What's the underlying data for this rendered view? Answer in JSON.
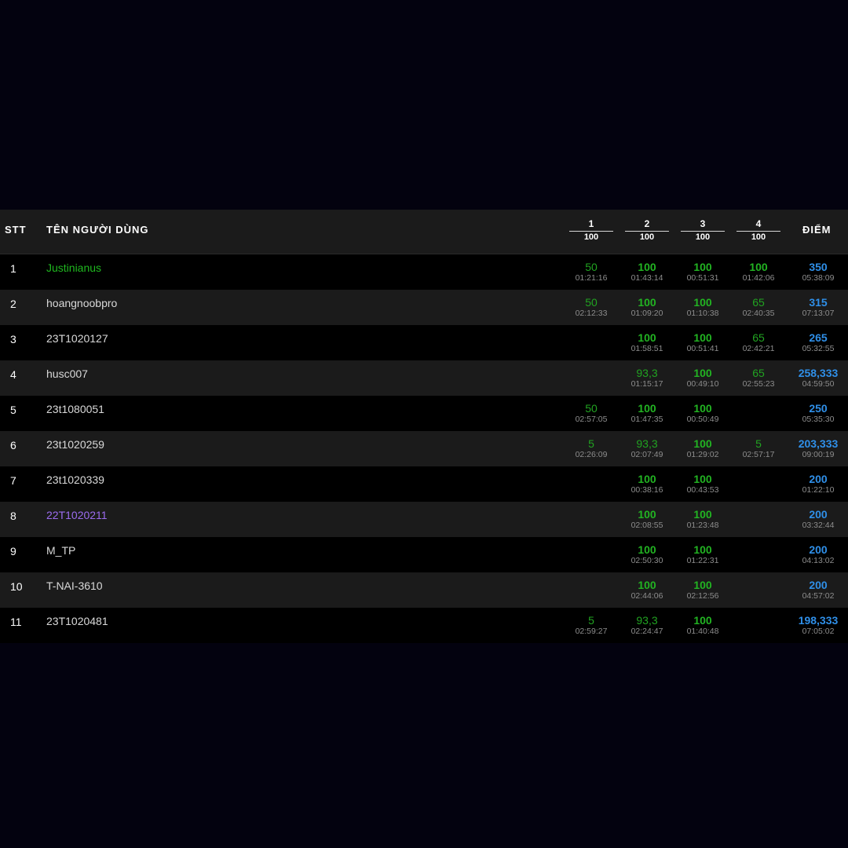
{
  "header": {
    "stt": "STT",
    "name": "TÊN NGƯỜI DÙNG",
    "score": "ĐIỂM",
    "problems": [
      {
        "num": "1",
        "max": "100"
      },
      {
        "num": "2",
        "max": "100"
      },
      {
        "num": "3",
        "max": "100"
      },
      {
        "num": "4",
        "max": "100"
      }
    ]
  },
  "colors": {
    "background": "#03020f",
    "row_dark": "#000000",
    "row_light": "#1b1b1b",
    "points_green": "#22b322",
    "score_blue": "#2f8fe8",
    "user_green": "#1fb81f",
    "user_purple": "#9b6cf0"
  },
  "rows": [
    {
      "rank": "1",
      "user": "Justinianus",
      "user_color": "green",
      "cells": [
        {
          "p": "50",
          "t": "01:21:16"
        },
        {
          "p": "100",
          "t": "01:43:14"
        },
        {
          "p": "100",
          "t": "00:51:31"
        },
        {
          "p": "100",
          "t": "01:42:06"
        }
      ],
      "score": "350",
      "total_time": "05:38:09"
    },
    {
      "rank": "2",
      "user": "hoangnoobpro",
      "user_color": "default",
      "cells": [
        {
          "p": "50",
          "t": "02:12:33"
        },
        {
          "p": "100",
          "t": "01:09:20"
        },
        {
          "p": "100",
          "t": "01:10:38"
        },
        {
          "p": "65",
          "t": "02:40:35"
        }
      ],
      "score": "315",
      "total_time": "07:13:07"
    },
    {
      "rank": "3",
      "user": "23T1020127",
      "user_color": "default",
      "cells": [
        null,
        {
          "p": "100",
          "t": "01:58:51"
        },
        {
          "p": "100",
          "t": "00:51:41"
        },
        {
          "p": "65",
          "t": "02:42:21"
        }
      ],
      "score": "265",
      "total_time": "05:32:55"
    },
    {
      "rank": "4",
      "user": "husc007",
      "user_color": "default",
      "cells": [
        null,
        {
          "p": "93,3",
          "t": "01:15:17"
        },
        {
          "p": "100",
          "t": "00:49:10"
        },
        {
          "p": "65",
          "t": "02:55:23"
        }
      ],
      "score": "258,333",
      "total_time": "04:59:50"
    },
    {
      "rank": "5",
      "user": "23t1080051",
      "user_color": "default",
      "cells": [
        {
          "p": "50",
          "t": "02:57:05"
        },
        {
          "p": "100",
          "t": "01:47:35"
        },
        {
          "p": "100",
          "t": "00:50:49"
        },
        null
      ],
      "score": "250",
      "total_time": "05:35:30"
    },
    {
      "rank": "6",
      "user": "23t1020259",
      "user_color": "default",
      "cells": [
        {
          "p": "5",
          "t": "02:26:09"
        },
        {
          "p": "93,3",
          "t": "02:07:49"
        },
        {
          "p": "100",
          "t": "01:29:02"
        },
        {
          "p": "5",
          "t": "02:57:17"
        }
      ],
      "score": "203,333",
      "total_time": "09:00:19"
    },
    {
      "rank": "7",
      "user": "23t1020339",
      "user_color": "default",
      "cells": [
        null,
        {
          "p": "100",
          "t": "00:38:16"
        },
        {
          "p": "100",
          "t": "00:43:53"
        },
        null
      ],
      "score": "200",
      "total_time": "01:22:10"
    },
    {
      "rank": "8",
      "user": "22T1020211",
      "user_color": "purple",
      "cells": [
        null,
        {
          "p": "100",
          "t": "02:08:55"
        },
        {
          "p": "100",
          "t": "01:23:48"
        },
        null
      ],
      "score": "200",
      "total_time": "03:32:44"
    },
    {
      "rank": "9",
      "user": "M_TP",
      "user_color": "default",
      "cells": [
        null,
        {
          "p": "100",
          "t": "02:50:30"
        },
        {
          "p": "100",
          "t": "01:22:31"
        },
        null
      ],
      "score": "200",
      "total_time": "04:13:02"
    },
    {
      "rank": "10",
      "user": "T-NAI-3610",
      "user_color": "default",
      "cells": [
        null,
        {
          "p": "100",
          "t": "02:44:06"
        },
        {
          "p": "100",
          "t": "02:12:56"
        },
        null
      ],
      "score": "200",
      "total_time": "04:57:02"
    },
    {
      "rank": "11",
      "user": "23T1020481",
      "user_color": "default",
      "cells": [
        {
          "p": "5",
          "t": "02:59:27"
        },
        {
          "p": "93,3",
          "t": "02:24:47"
        },
        {
          "p": "100",
          "t": "01:40:48"
        },
        null
      ],
      "score": "198,333",
      "total_time": "07:05:02"
    }
  ]
}
